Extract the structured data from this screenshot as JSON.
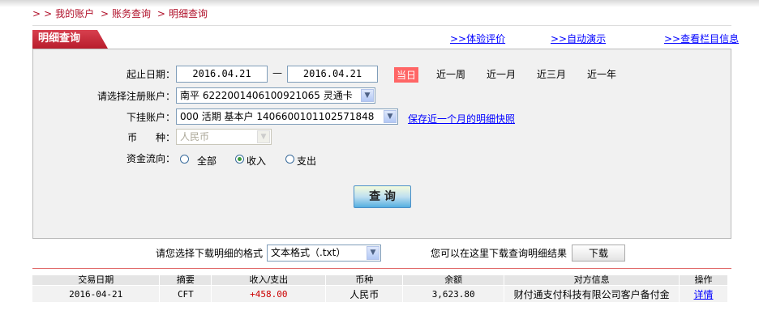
{
  "breadcrumb": [
    ">",
    ">",
    "我的账户",
    ">",
    "账务查询",
    ">",
    "明细查询"
  ],
  "tab": {
    "title": "明细查询"
  },
  "top_links": [
    ">>体验评价",
    ">>自动演示",
    ">>查看栏目信息"
  ],
  "form": {
    "date_label": "起止日期：",
    "start_date": "2016.04.21",
    "dash": "—",
    "end_date": "2016.04.21",
    "quick": [
      "当日",
      "近一周",
      "近一月",
      "近三月",
      "近一年"
    ],
    "account_label": "请选择注册账户：",
    "account_value": "南平  6222001406100921065  灵通卡",
    "sub_label": "下挂账户：",
    "sub_value": "000  活期  基本户  1406600101102571848",
    "snapshot_link": "保存近一个月的明细快照",
    "currency_label": "币      种：",
    "currency_value": "人民币",
    "flow_label": "资金流向：",
    "flow_options": [
      "全部",
      "收入",
      "支出"
    ],
    "flow_selected": "收入",
    "query_button": "查 询"
  },
  "download": {
    "format_label": "请您选择下载明细的格式",
    "format_value": "文本格式（.txt）",
    "hint": "您可以在这里下载查询明细结果",
    "button": "下载"
  },
  "table": {
    "headers": [
      "交易日期",
      "摘要",
      "收入/支出",
      "币种",
      "余额",
      "对方信息",
      "操作"
    ],
    "rows": [
      [
        "2016-04-21",
        "CFT",
        "+458.00",
        "人民币",
        "3,623.80",
        "财付通支付科技有限公司客户备付金",
        "详情"
      ]
    ]
  },
  "colors": {
    "brand_red": "#b81d2c",
    "link": "#0000ff",
    "income": "#cc0000",
    "today_bg": "#ff6666"
  }
}
